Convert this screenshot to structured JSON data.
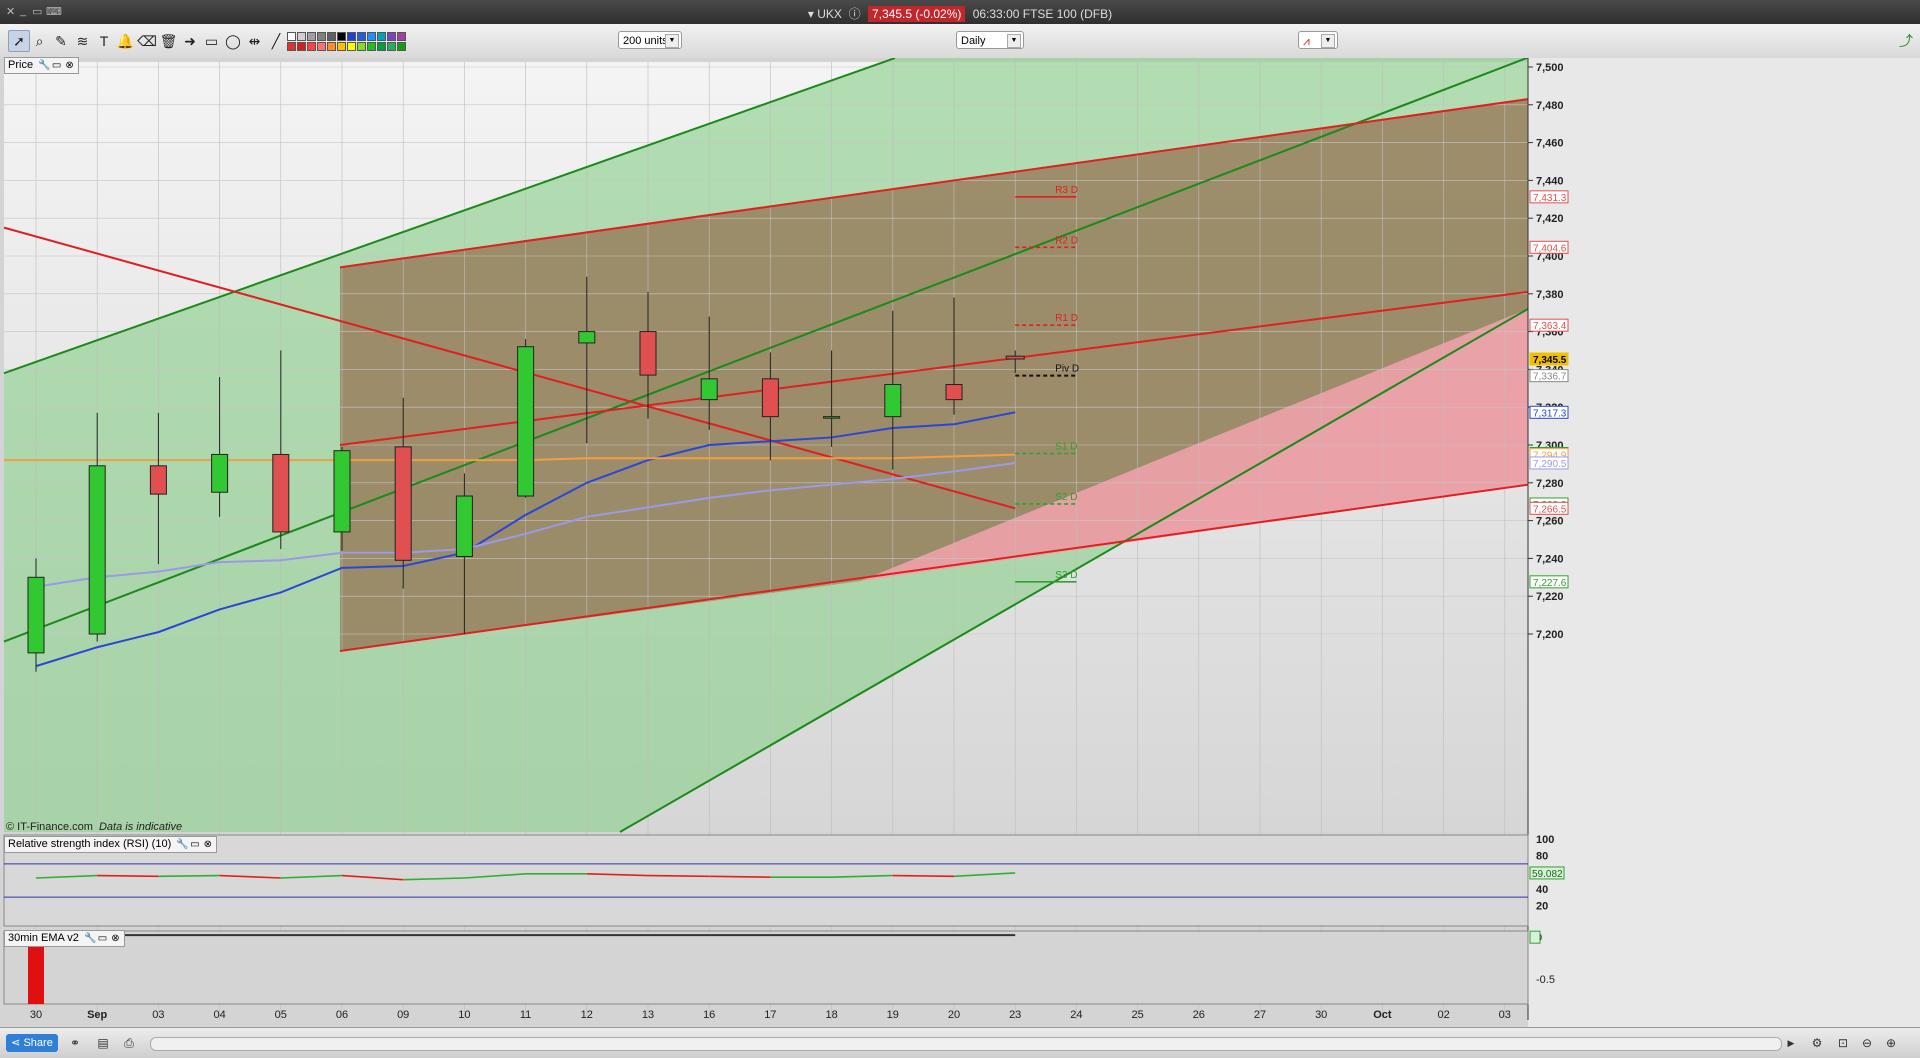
{
  "window": {
    "symbol": "UKX",
    "price_badge": "7,345.5 (-0.02%)",
    "title_info": "06:33:00 FTSE 100 (DFB)"
  },
  "toolbar": {
    "units_select": "200 units",
    "period_select": "Daily",
    "tools": [
      "pointer-icon",
      "zoom-icon",
      "drawing-icon",
      "fib-icon",
      "text-icon",
      "alert-icon",
      "erase-icon",
      "delete-icon",
      "arrow-icon",
      "rectangle-icon",
      "ellipse-icon",
      "hline-icon",
      "trendline-icon"
    ],
    "swatch_colors_top": [
      "#ffffff",
      "#d0d0d0",
      "#a0a0a0",
      "#808080",
      "#606060",
      "#000000",
      "#1e3fcf",
      "#2060e0",
      "#1e90ff",
      "#00a0c0",
      "#8040c0",
      "#a040a0"
    ],
    "swatch_colors_bottom": [
      "#e03030",
      "#d02020",
      "#ff4040",
      "#ff7070",
      "#ff9020",
      "#ffc000",
      "#ffff00",
      "#80e020",
      "#20c020",
      "#00a040",
      "#20b060",
      "#10a010"
    ]
  },
  "panels": {
    "price_label": "Price",
    "rsi_label": "Relative strength index (RSI) (10)",
    "ema_label": "30min EMA v2"
  },
  "watermark": {
    "source": "© IT-Finance.com",
    "note": "Data is indicative"
  },
  "statusbar": {
    "share_label": "Share"
  },
  "colors": {
    "bull": "#32c832",
    "bear": "#e05050",
    "green_line": "#1a8a1a",
    "red_line": "#e02020",
    "ma_blue": "#2a46d8",
    "ma_lavender": "#9a9ae8",
    "ma_orange": "#f0a040"
  },
  "chart_data": {
    "type": "candlestick",
    "x_labels": [
      "30",
      "Sep",
      "03",
      "04",
      "05",
      "06",
      "09",
      "10",
      "11",
      "12",
      "13",
      "16",
      "17",
      "18",
      "19",
      "20",
      "23",
      "24",
      "25",
      "26",
      "27",
      "30",
      "Oct",
      "02",
      "03"
    ],
    "y_ticks": [
      "7,500",
      "7,480",
      "7,460",
      "7,440",
      "7,420",
      "7,400",
      "7,380",
      "7,360",
      "7,340",
      "7,320",
      "7,300",
      "7,280",
      "7,260",
      "7,240",
      "7,220",
      "7,200"
    ],
    "ylim": [
      7185,
      7505
    ],
    "candles": [
      {
        "date": "30",
        "open": 7190,
        "high": 7240,
        "low": 7180,
        "close": 7230
      },
      {
        "date": "Sep",
        "open": 7200,
        "high": 7317,
        "low": 7196,
        "close": 7289
      },
      {
        "date": "03",
        "open": 7289,
        "high": 7317,
        "low": 7237,
        "close": 7274
      },
      {
        "date": "04",
        "open": 7275,
        "high": 7336,
        "low": 7262,
        "close": 7295
      },
      {
        "date": "05",
        "open": 7295,
        "high": 7350,
        "low": 7245,
        "close": 7254
      },
      {
        "date": "06",
        "open": 7254,
        "high": 7299,
        "low": 7244,
        "close": 7297
      },
      {
        "date": "09",
        "open": 7299,
        "high": 7325,
        "low": 7224,
        "close": 7239
      },
      {
        "date": "10",
        "open": 7241,
        "high": 7285,
        "low": 7200,
        "close": 7273
      },
      {
        "date": "11",
        "open": 7273,
        "high": 7356,
        "low": 7272,
        "close": 7352
      },
      {
        "date": "12",
        "open": 7354,
        "high": 7389,
        "low": 7301,
        "close": 7360
      },
      {
        "date": "13",
        "open": 7360,
        "high": 7381,
        "low": 7314,
        "close": 7337
      },
      {
        "date": "16",
        "open": 7324,
        "high": 7368,
        "low": 7308,
        "close": 7335
      },
      {
        "date": "17",
        "open": 7335,
        "high": 7349,
        "low": 7292,
        "close": 7315
      },
      {
        "date": "18",
        "open": 7315,
        "high": 7350,
        "low": 7299,
        "close": 7315
      },
      {
        "date": "19",
        "open": 7315,
        "high": 7371,
        "low": 7287,
        "close": 7332
      },
      {
        "date": "20",
        "open": 7332,
        "high": 7378,
        "low": 7316,
        "close": 7324
      },
      {
        "date": "23",
        "open": 7347,
        "high": 7350,
        "low": 7338,
        "close": 7345.5
      }
    ],
    "moving_averages": [
      {
        "color": "#2a46d8",
        "values": [
          7183,
          7193,
          7201,
          7213,
          7222,
          7235,
          7236,
          7243,
          7263,
          7280,
          7292,
          7300,
          7302,
          7304,
          7309,
          7311,
          7317.3
        ]
      },
      {
        "color": "#9a9ae8",
        "values": [
          7225,
          7230,
          7233,
          7238,
          7239,
          7243,
          7243,
          7245,
          7253,
          7262,
          7267,
          7272,
          7276,
          7279,
          7282,
          7286,
          7290.5
        ]
      },
      {
        "color": "#f0a040",
        "values": [
          7292,
          7292,
          7292,
          7292,
          7292,
          7292,
          7292,
          7292,
          7292,
          7293,
          7293,
          7293,
          7293,
          7293,
          7293,
          7294,
          7294.9
        ]
      }
    ],
    "pivots": [
      {
        "label": "R3 D",
        "value": 7431.3,
        "style": "solid"
      },
      {
        "label": "R2 D",
        "value": 7404.6,
        "style": "dashed"
      },
      {
        "label": "R1 D",
        "value": 7363.4,
        "style": "dashed"
      },
      {
        "label": "Piv D",
        "value": 7336.7,
        "style": "dashed"
      },
      {
        "label": "S1 D",
        "value": 7295.5,
        "style": "dashed"
      },
      {
        "label": "S2 D",
        "value": 7268.8,
        "style": "dashed"
      },
      {
        "label": "S3 D",
        "value": 7227.6,
        "style": "solid"
      }
    ],
    "axis_badges": [
      {
        "text": "7,431.3",
        "color": "#e05050"
      },
      {
        "text": "7,404.6",
        "color": "#e05050"
      },
      {
        "text": "7,363.4",
        "color": "#e05050"
      },
      {
        "text": "7,345.5",
        "color": "#f0c000"
      },
      {
        "text": "7,336.7",
        "color": "#888888"
      },
      {
        "text": "7,317.3",
        "color": "#2a46d8"
      },
      {
        "text": "7,295.5",
        "color": "#30a030"
      },
      {
        "text": "7,294.9",
        "color": "#f0a040"
      },
      {
        "text": "7,290.5",
        "color": "#9a9ae8"
      },
      {
        "text": "7,268.8",
        "color": "#30a030"
      },
      {
        "text": "7,266.5",
        "color": "#e05050"
      },
      {
        "text": "7,227.6",
        "color": "#30a030"
      }
    ],
    "rsi": {
      "ticks": [
        "100",
        "80",
        "60",
        "40",
        "20"
      ],
      "ylim": [
        0,
        100
      ],
      "levels": [
        70,
        30
      ],
      "values": [
        53,
        56,
        55,
        56,
        53,
        56,
        51,
        53,
        58,
        58,
        56,
        55,
        54,
        54,
        56,
        55,
        59.082
      ],
      "current_label": "59.082"
    },
    "ema_panel": {
      "ticks": [
        "0",
        "-0.5"
      ],
      "ylim": [
        -0.8,
        0.05
      ]
    }
  }
}
